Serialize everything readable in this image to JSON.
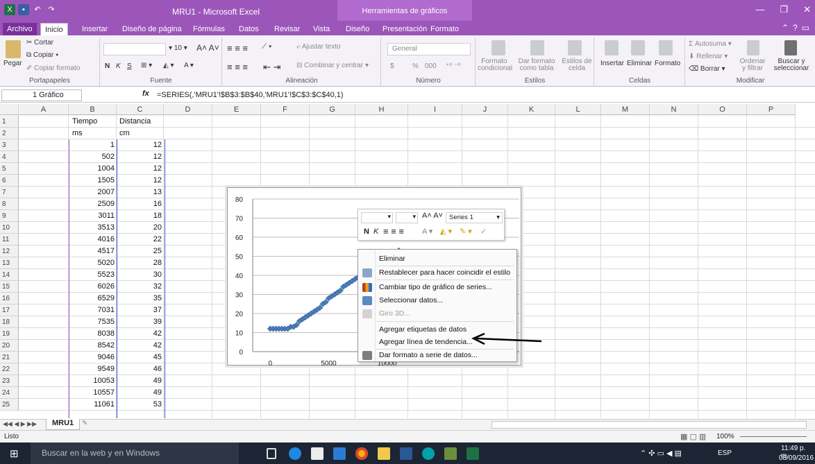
{
  "window": {
    "title": "MRU1 - Microsoft Excel",
    "context_tab_group": "Herramientas de gráficos"
  },
  "tabs": [
    "Archivo",
    "Inicio",
    "Insertar",
    "Diseño de página",
    "Fórmulas",
    "Datos",
    "Revisar",
    "Vista",
    "Diseño",
    "Presentación",
    "Formato"
  ],
  "ribbon": {
    "portapapeles": {
      "paste": "Pegar",
      "cut": "Cortar",
      "copy": "Copiar ▾",
      "format_painter": "Copiar formato",
      "label": "Portapapeles"
    },
    "fuente": {
      "size": "10",
      "bold": "N",
      "italic": "K",
      "underline": "S",
      "label": "Fuente"
    },
    "alineacion": {
      "wrap": "Ajustar texto",
      "merge": "Combinar y centrar",
      "label": "Alineación"
    },
    "numero": {
      "format": "General",
      "currency": "$",
      "percent": "%",
      "thousands": "000",
      "label": "Número"
    },
    "estilos": {
      "conditional": "Formato condicional",
      "as_table": "Dar formato como tabla",
      "cell_styles": "Estilos de celda",
      "label": "Estilos"
    },
    "celdas": {
      "insert": "Insertar",
      "delete": "Eliminar",
      "format": "Formato",
      "label": "Celdas"
    },
    "modificar": {
      "autosum": "Autosuma",
      "fill": "Rellenar",
      "clear": "Borrar",
      "sort": "Ordenar y filtrar",
      "find": "Buscar y seleccionar",
      "label": "Modificar"
    }
  },
  "formula_bar": {
    "name_box": "1 Gráfico",
    "fx": "fx",
    "formula": "=SERIES(,'MRU1'!$B$3:$B$40,'MRU1'!$C$3:$C$40,1)"
  },
  "columns": [
    "A",
    "B",
    "C",
    "D",
    "E",
    "F",
    "G",
    "H",
    "I",
    "J",
    "K",
    "L",
    "M",
    "N",
    "O",
    "P"
  ],
  "rows": [
    "1",
    "2",
    "3",
    "4",
    "5",
    "6",
    "7",
    "8",
    "9",
    "10",
    "11",
    "12",
    "13",
    "14",
    "15",
    "16",
    "17",
    "18",
    "19",
    "20",
    "21",
    "22",
    "23",
    "24",
    "25"
  ],
  "cells": {
    "B1": "Tiempo",
    "C1": "Distancia",
    "B2": "ms",
    "C2": "cm",
    "tiempo": [
      "1",
      "502",
      "1004",
      "1505",
      "2007",
      "2509",
      "3011",
      "3513",
      "4016",
      "4517",
      "5020",
      "5523",
      "6026",
      "6529",
      "7031",
      "7535",
      "8038",
      "8542",
      "9046",
      "9549",
      "10053",
      "10557",
      "11061"
    ],
    "distancia": [
      "12",
      "12",
      "12",
      "12",
      "13",
      "16",
      "18",
      "20",
      "22",
      "25",
      "28",
      "30",
      "32",
      "35",
      "37",
      "39",
      "42",
      "42",
      "45",
      "46",
      "49",
      "49",
      "53"
    ]
  },
  "chart_data": {
    "type": "scatter",
    "title": "",
    "xlabel": "",
    "ylabel": "",
    "xlim": [
      -1500,
      11800
    ],
    "ylim": [
      0,
      80
    ],
    "x_ticks": [
      "0",
      "5000",
      "10000"
    ],
    "y_ticks": [
      "0",
      "10",
      "20",
      "30",
      "40",
      "50",
      "60",
      "70",
      "80"
    ],
    "grid": true,
    "legend": "none",
    "series": [
      {
        "color": "#4a7ebb",
        "x": [
          0,
          250,
          500,
          750,
          1000,
          1250,
          1500,
          1750,
          2000,
          2250,
          2500,
          2750,
          3000,
          3250,
          3500,
          3750,
          4000,
          4250,
          4500,
          4750,
          5000,
          5250,
          5500,
          5750,
          6000,
          6250,
          6500,
          6750,
          7000,
          7250,
          7500,
          7750,
          8000,
          8250,
          8500,
          8750,
          9000,
          9250,
          9500,
          9750,
          10000,
          10250,
          10500,
          10750,
          11000
        ],
        "y": [
          12,
          12,
          12,
          12,
          12,
          12,
          12,
          13,
          13,
          14,
          16,
          17,
          18,
          19,
          20,
          21,
          22,
          23,
          25,
          26,
          28,
          29,
          30,
          31,
          32,
          34,
          35,
          36,
          37,
          38,
          39,
          40,
          42,
          42,
          42,
          44,
          45,
          45,
          46,
          48,
          49,
          49,
          49,
          51,
          53
        ]
      }
    ]
  },
  "minibar": {
    "series_select": "Series 1",
    "bold": "N",
    "italic": "K"
  },
  "context_menu": [
    {
      "label": "Eliminar",
      "icon": "none",
      "enabled": true
    },
    {
      "label": "Restablecer para hacer coincidir el estilo",
      "icon": "reset-style-icon",
      "enabled": true
    },
    {
      "label": "Cambiar tipo de gráfico de series...",
      "icon": "chart-type-icon",
      "enabled": true
    },
    {
      "label": "Seleccionar datos...",
      "icon": "select-data-icon",
      "enabled": true
    },
    {
      "label": "Giro 3D...",
      "icon": "rotate-3d-icon",
      "enabled": false
    },
    {
      "label": "Agregar etiquetas de datos",
      "icon": "none",
      "enabled": true
    },
    {
      "label": "Agregar línea de tendencia...",
      "icon": "none",
      "enabled": true
    },
    {
      "label": "Dar formato a serie de datos...",
      "icon": "format-series-icon",
      "enabled": true
    }
  ],
  "sheet_tab": "MRU1",
  "status": {
    "ready": "Listo",
    "zoom": "100%"
  },
  "taskbar": {
    "search": "Buscar en la web y en Windows",
    "lang": "ESP",
    "time": "11:49 p. m.",
    "date": "08/09/2016"
  }
}
